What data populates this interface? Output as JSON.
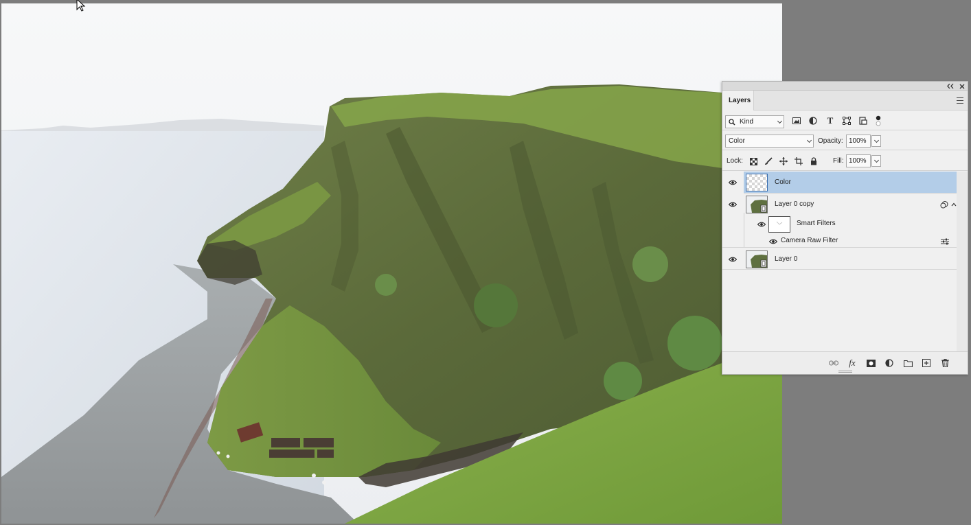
{
  "panel": {
    "tab_label": "Layers",
    "collapse_icon": "double-chevron-left-icon",
    "close_icon": "close-icon",
    "menu_icon": "panel-menu-icon",
    "filter": {
      "search_icon": "search-icon",
      "kind_value": "Kind",
      "filter_icons": [
        "image-filter-icon",
        "adjustment-filter-icon",
        "type-filter-icon",
        "shape-filter-icon",
        "smart-object-filter-icon",
        "filter-toggle-icon"
      ]
    },
    "blend_mode": "Color",
    "opacity_label": "Opacity:",
    "opacity_value": "100%",
    "lock_label": "Lock:",
    "lock_icons": [
      "lock-transparent-pixels-icon",
      "lock-image-pixels-icon",
      "lock-position-icon",
      "lock-artboard-icon",
      "lock-all-icon"
    ],
    "fill_label": "Fill:",
    "fill_value": "100%",
    "layers": [
      {
        "name": "Color",
        "selected": true
      },
      {
        "name": "Layer 0 copy",
        "selected": false,
        "smart_filters_label": "Smart Filters",
        "filter_name": "Camera Raw Filter"
      },
      {
        "name": "Layer 0",
        "selected": false
      }
    ],
    "bottom_icons": [
      "link-layers-icon",
      "fx-icon",
      "add-mask-icon",
      "adjustment-layer-icon",
      "group-folder-icon",
      "new-layer-icon",
      "trash-icon"
    ],
    "colors": {
      "selection": "#b3cde8",
      "panel_bg": "#f0f0f0",
      "workspace": "#7d7d7d"
    }
  }
}
